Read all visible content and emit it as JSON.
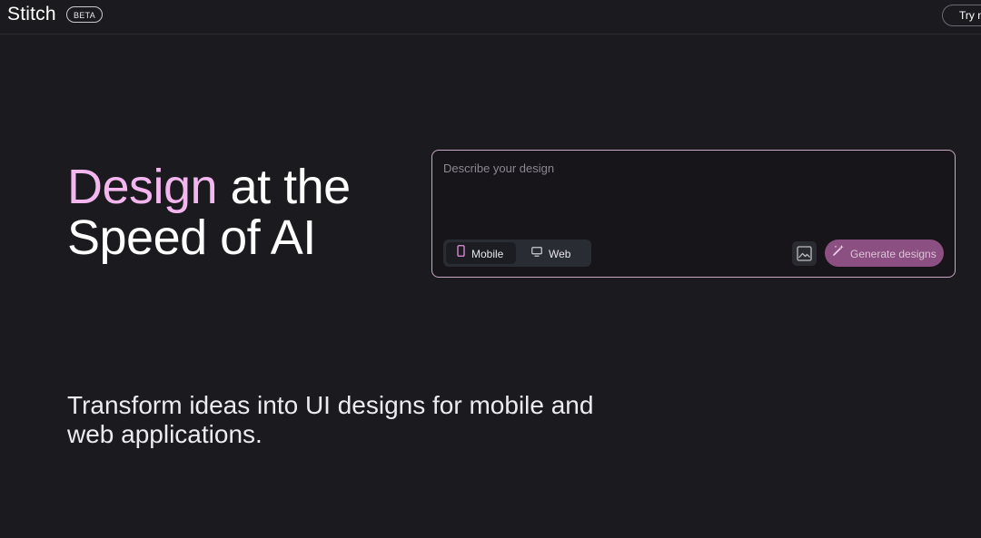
{
  "header": {
    "brand": "Stitch",
    "badge": "BETA",
    "try_button": "Try n"
  },
  "hero": {
    "title_accent": "Design",
    "title_rest_line1": " at the",
    "title_line2": "Speed of AI",
    "subtitle": "Transform ideas into UI designs for mobile and web applications."
  },
  "prompt": {
    "placeholder": "Describe your design",
    "value": "",
    "device_options": [
      {
        "label": "Mobile",
        "icon": "smartphone-icon",
        "selected": true
      },
      {
        "label": "Web",
        "icon": "monitor-icon",
        "selected": false
      }
    ],
    "image_button_icon": "image-icon",
    "generate_label": "Generate designs",
    "generate_icon": "magic-wand-icon"
  },
  "colors": {
    "background": "#1b1b1f",
    "accent_text": "#f3b6ee",
    "panel_border": "#c8a8c4",
    "generate_button": "#8c4f82"
  }
}
